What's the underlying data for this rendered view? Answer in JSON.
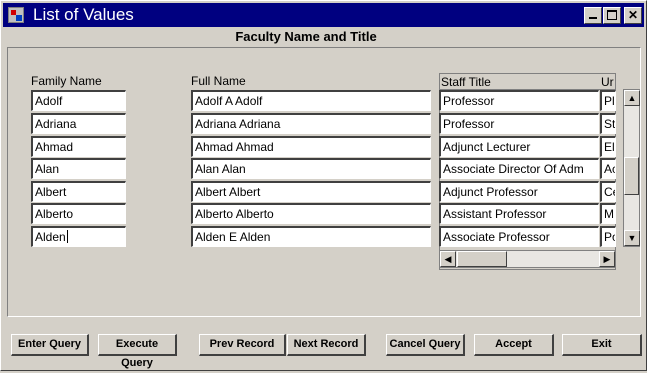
{
  "window": {
    "title": "List of Values"
  },
  "heading": "Faculty Name and Title",
  "columns": {
    "family": "Family Name",
    "full": "Full Name",
    "staff": "Staff Title",
    "unit": "Ur"
  },
  "rows": [
    {
      "family": "Adolf",
      "full": "Adolf A Adolf",
      "staff": "Professor",
      "unit": "Pl"
    },
    {
      "family": "Adriana",
      "full": "Adriana  Adriana",
      "staff": "Professor",
      "unit": "St"
    },
    {
      "family": "Ahmad",
      "full": "Ahmad  Ahmad",
      "staff": "Adjunct Lecturer",
      "unit": "El"
    },
    {
      "family": "Alan",
      "full": "Alan  Alan",
      "staff": "Associate Director Of Adm",
      "unit": "Ac"
    },
    {
      "family": "Albert",
      "full": "Albert  Albert",
      "staff": "Adjunct Professor",
      "unit": "Ce"
    },
    {
      "family": "Alberto",
      "full": "Alberto  Alberto",
      "staff": "Assistant Professor",
      "unit": "M"
    },
    {
      "family": "Alden",
      "full": "Alden E Alden",
      "staff": "Associate Professor",
      "unit": "Po"
    }
  ],
  "buttons": {
    "enter_query": "Enter Query",
    "execute_query": "Execute Query",
    "prev_record": "Prev Record",
    "next_record": "Next Record",
    "cancel_query": "Cancel Query",
    "accept": "Accept",
    "exit": "Exit"
  },
  "icons": {
    "app": "app-icon",
    "minimize": "minimize-icon",
    "maximize": "maximize-icon",
    "close": "close-icon",
    "scroll_left": "arrow-left-icon",
    "scroll_right": "arrow-right-icon",
    "scroll_up": "arrow-up-icon",
    "scroll_down": "arrow-down-icon"
  }
}
